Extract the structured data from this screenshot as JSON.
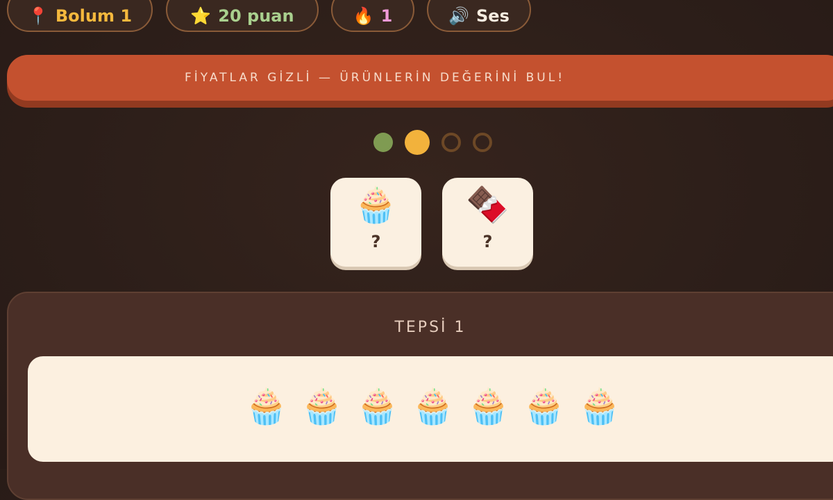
{
  "header": {
    "level": {
      "icon": "📍",
      "label": "Bolum 1"
    },
    "score": {
      "icon": "⭐",
      "label": "20 puan"
    },
    "streak": {
      "icon": "🔥",
      "label": "1"
    },
    "sound": {
      "icon": "🔊",
      "label": "Ses"
    }
  },
  "banner": {
    "text": "FİYATLAR GİZLİ — ÜRÜNLERİN DEĞERİNİ BUL!"
  },
  "progress": {
    "total": 4,
    "current": 2,
    "completed": 1
  },
  "products": [
    {
      "icon": "🧁",
      "name": "cupcake",
      "price": "?"
    },
    {
      "icon": "🍫",
      "name": "chocolate-bar",
      "price": "?"
    }
  ],
  "tray": {
    "title": "TEPSİ 1",
    "items": [
      "🧁",
      "🧁",
      "🧁",
      "🧁",
      "🧁",
      "🧁",
      "🧁"
    ]
  },
  "colors": {
    "accent": "#c4512f",
    "gold": "#f2b23c",
    "done": "#7f9b52",
    "background": "#2c1e19"
  }
}
